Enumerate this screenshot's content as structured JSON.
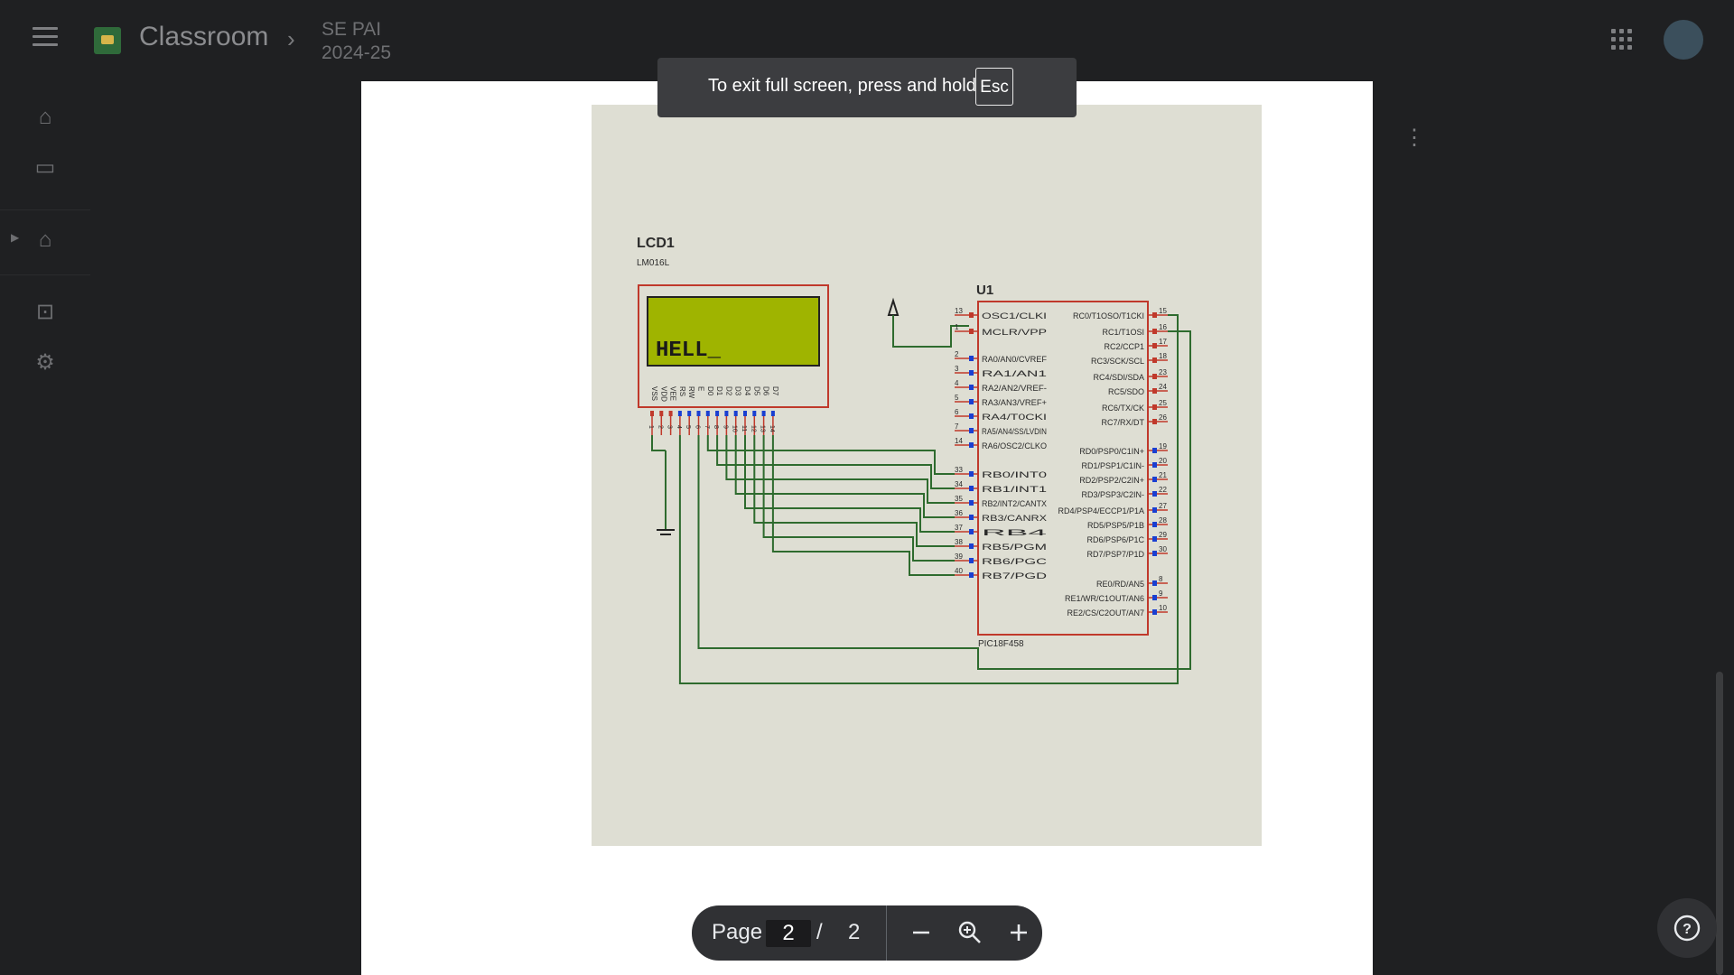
{
  "app": {
    "title": "Classroom",
    "class_name_line1": "SE PAI",
    "class_name_line2": "2024-25"
  },
  "sidebar": {
    "icons": [
      "home-icon",
      "calendar-icon",
      "enrolled-classes-icon",
      "archived-icon",
      "settings-icon"
    ]
  },
  "fullscreen_toast": {
    "message": "To exit full screen, press and hold",
    "key": "Esc"
  },
  "viewer": {
    "page_label": "Page",
    "current_page": "2",
    "separator": "/",
    "total_pages": "2"
  },
  "schematic": {
    "lcd_ref": "LCD1",
    "lcd_part": "LM016L",
    "lcd_display_text": "HELL_",
    "mcu_ref": "U1",
    "mcu_part": "PIC18F458",
    "mcu_left_pins": [
      {
        "num": "13",
        "name": "OSC1/CLKI"
      },
      {
        "num": "1",
        "name": "MCLR/VPP"
      },
      {
        "num": "2",
        "name": "RA0/AN0/CVREF"
      },
      {
        "num": "3",
        "name": "RA1/AN1"
      },
      {
        "num": "4",
        "name": "RA2/AN2/VREF-"
      },
      {
        "num": "5",
        "name": "RA3/AN3/VREF+"
      },
      {
        "num": "6",
        "name": "RA4/T0CKI"
      },
      {
        "num": "7",
        "name": "RA5/AN4/SS/LVDIN"
      },
      {
        "num": "14",
        "name": "RA6/OSC2/CLKO"
      },
      {
        "num": "33",
        "name": "RB0/INT0"
      },
      {
        "num": "34",
        "name": "RB1/INT1"
      },
      {
        "num": "35",
        "name": "RB2/INT2/CANTX"
      },
      {
        "num": "36",
        "name": "RB3/CANRX"
      },
      {
        "num": "37",
        "name": "RB4"
      },
      {
        "num": "38",
        "name": "RB5/PGM"
      },
      {
        "num": "39",
        "name": "RB6/PGC"
      },
      {
        "num": "40",
        "name": "RB7/PGD"
      }
    ],
    "mcu_right_pins": [
      {
        "num": "15",
        "name": "RC0/T1OSO/T1CKI"
      },
      {
        "num": "16",
        "name": "RC1/T1OSI"
      },
      {
        "num": "17",
        "name": "RC2/CCP1"
      },
      {
        "num": "18",
        "name": "RC3/SCK/SCL"
      },
      {
        "num": "23",
        "name": "RC4/SDI/SDA"
      },
      {
        "num": "24",
        "name": "RC5/SDO"
      },
      {
        "num": "25",
        "name": "RC6/TX/CK"
      },
      {
        "num": "26",
        "name": "RC7/RX/DT"
      },
      {
        "num": "19",
        "name": "RD0/PSP0/C1IN+"
      },
      {
        "num": "20",
        "name": "RD1/PSP1/C1IN-"
      },
      {
        "num": "21",
        "name": "RD2/PSP2/C2IN+"
      },
      {
        "num": "22",
        "name": "RD3/PSP3/C2IN-"
      },
      {
        "num": "27",
        "name": "RD4/PSP4/ECCP1/P1A"
      },
      {
        "num": "28",
        "name": "RD5/PSP5/P1B"
      },
      {
        "num": "29",
        "name": "RD6/PSP6/P1C"
      },
      {
        "num": "30",
        "name": "RD7/PSP7/P1D"
      },
      {
        "num": "8",
        "name": "RE0/RD/AN5"
      },
      {
        "num": "9",
        "name": "RE1/WR/C1OUT/AN6"
      },
      {
        "num": "10",
        "name": "RE2/CS/C2OUT/AN7"
      }
    ],
    "lcd_pin_labels": [
      "VSS",
      "VDD",
      "VEE",
      "RS",
      "RW",
      "E",
      "D0",
      "D1",
      "D2",
      "D3",
      "D4",
      "D5",
      "D6",
      "D7"
    ],
    "lcd_pin_numbers": [
      "1",
      "2",
      "3",
      "4",
      "5",
      "6",
      "7",
      "8",
      "9",
      "10",
      "11",
      "12",
      "13",
      "14"
    ]
  },
  "colors": {
    "lcd_screen": "#9fb400",
    "wire": "#2e6b2e",
    "component_outline": "#c0392b"
  }
}
